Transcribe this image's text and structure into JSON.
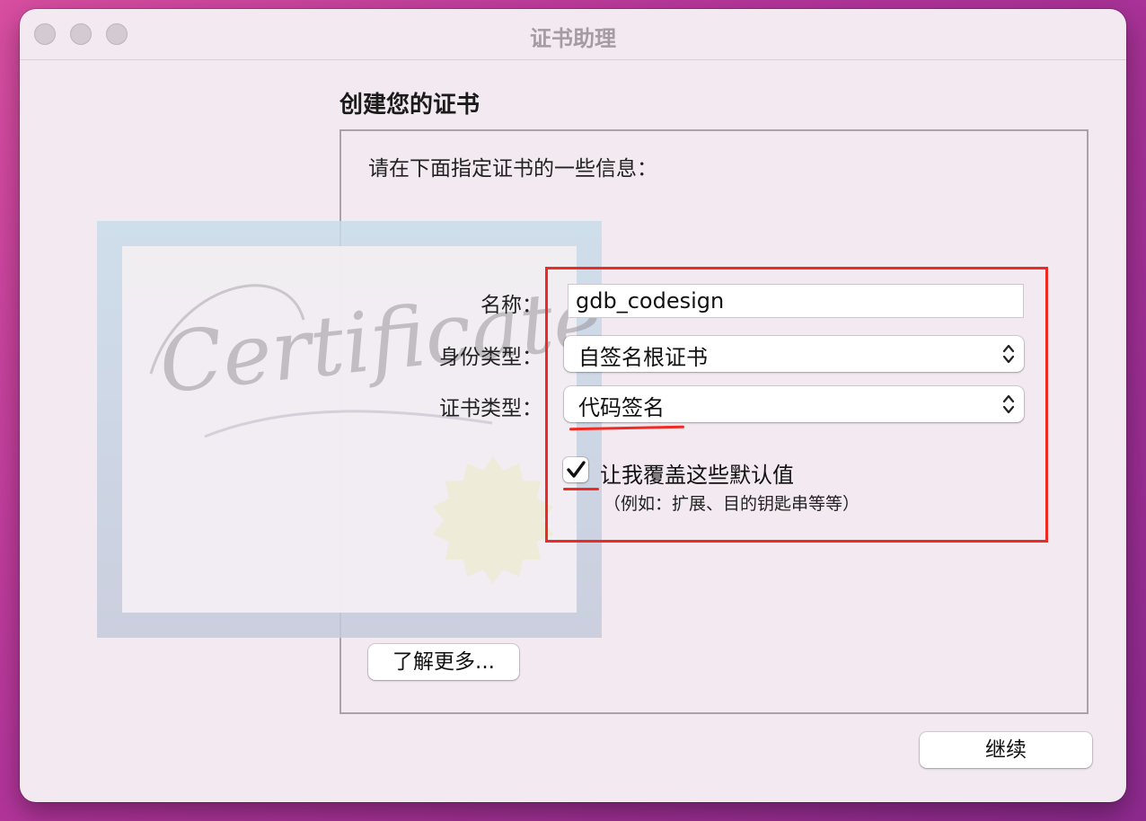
{
  "window": {
    "title": "证书助理",
    "controls": [
      "close",
      "minimize",
      "zoom"
    ]
  },
  "page": {
    "heading": "创建您的证书",
    "instruction": "请在下面指定证书的一些信息："
  },
  "illustration": {
    "text": "Certificate",
    "icon": "certificate-icon"
  },
  "form": {
    "name_label": "名称：",
    "name_value": "gdb_codesign",
    "identity_type_label": "身份类型：",
    "identity_type_value": "自签名根证书",
    "cert_type_label": "证书类型：",
    "cert_type_value": "代码签名",
    "override_checkbox_label": "让我覆盖这些默认值",
    "override_checked": true,
    "override_hint": "（例如：扩展、目的钥匙串等等）"
  },
  "buttons": {
    "learn_more": "了解更多...",
    "continue": "继续"
  },
  "annotations": {
    "highlight_color": "#ef2a22"
  }
}
